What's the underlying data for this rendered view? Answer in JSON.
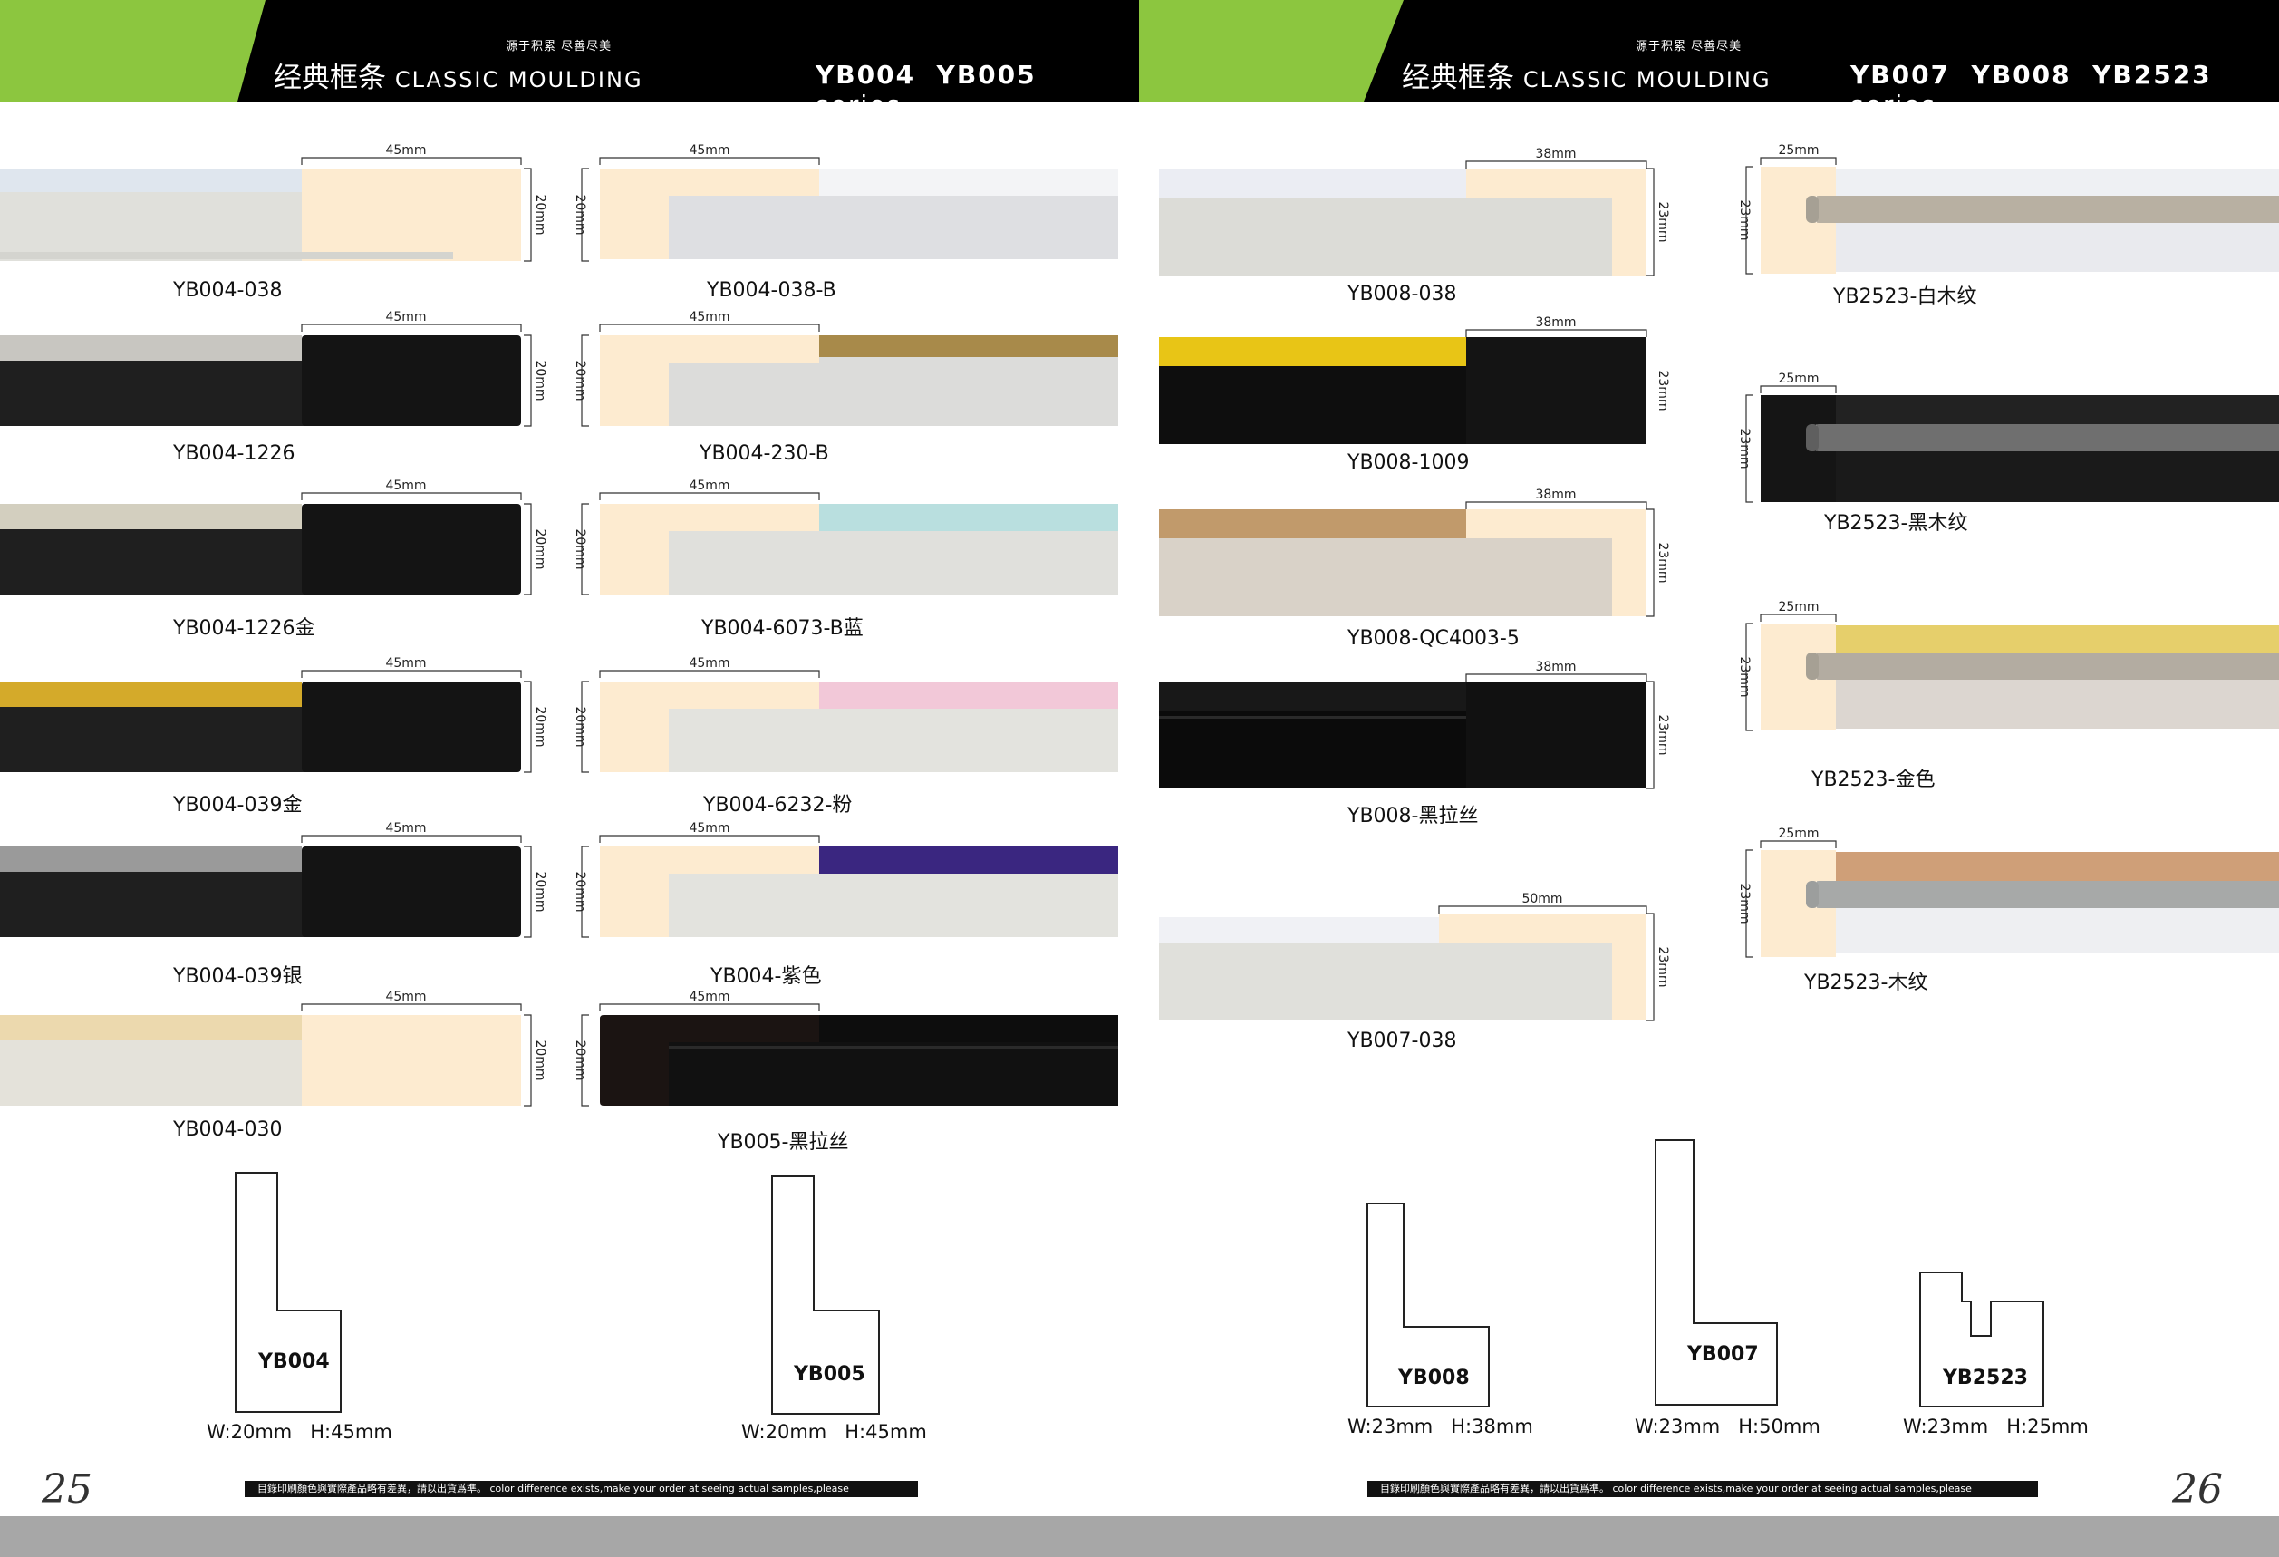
{
  "header": {
    "slogan": "源于积累 尽善尽美",
    "title_cn": "经典框条",
    "title_en": "CLASSIC MOULDING",
    "series_word": "series",
    "left_series": "YB004  YB005",
    "right_series": "YB007  YB008  YB2523",
    "green_color": "#8cc63f",
    "black_color": "#000000"
  },
  "dims": {
    "w45": "45mm",
    "h20": "20mm",
    "w38": "38mm",
    "h23": "23mm",
    "w25": "25mm",
    "w50": "50mm"
  },
  "products": {
    "yb004_038": "YB004-038",
    "yb004_1226": "YB004-1226",
    "yb004_1226_gold": "YB004-1226金",
    "yb004_039_gold": "YB004-039金",
    "yb004_039_silver": "YB004-039银",
    "yb004_030": "YB004-030",
    "yb004_038_b": "YB004-038-B",
    "yb004_230_b": "YB004-230-B",
    "yb004_6073_b": "YB004-6073-B蓝",
    "yb004_6232": "YB004-6232-粉",
    "yb004_purple": "YB004-紫色",
    "yb005_black": "YB005-黑拉丝",
    "yb008_038": "YB008-038",
    "yb008_1009": "YB008-1009",
    "yb008_qc": "YB008-QC4003-5",
    "yb008_black": "YB008-黑拉丝",
    "yb007_038": "YB007-038",
    "yb2523_white": "YB2523-白木纹",
    "yb2523_black": "YB2523-黑木纹",
    "yb2523_gold": "YB2523-金色",
    "yb2523_wood": "YB2523-木纹"
  },
  "profiles": {
    "yb004": {
      "name": "YB004",
      "dims": "W:20mm   H:45mm"
    },
    "yb005": {
      "name": "YB005",
      "dims": "W:20mm   H:45mm"
    },
    "yb008": {
      "name": "YB008",
      "dims": "W:23mm   H:38mm"
    },
    "yb007": {
      "name": "YB007",
      "dims": "W:23mm   H:50mm"
    },
    "yb2523": {
      "name": "YB2523",
      "dims": "W:23mm   H:25mm"
    }
  },
  "footer": {
    "page_left": "25",
    "page_right": "26",
    "disclaimer": "目錄印刷顏色與實際產品略有差異，請以出貨爲準。 color difference exists,make your order at seeing actual samples,please"
  }
}
